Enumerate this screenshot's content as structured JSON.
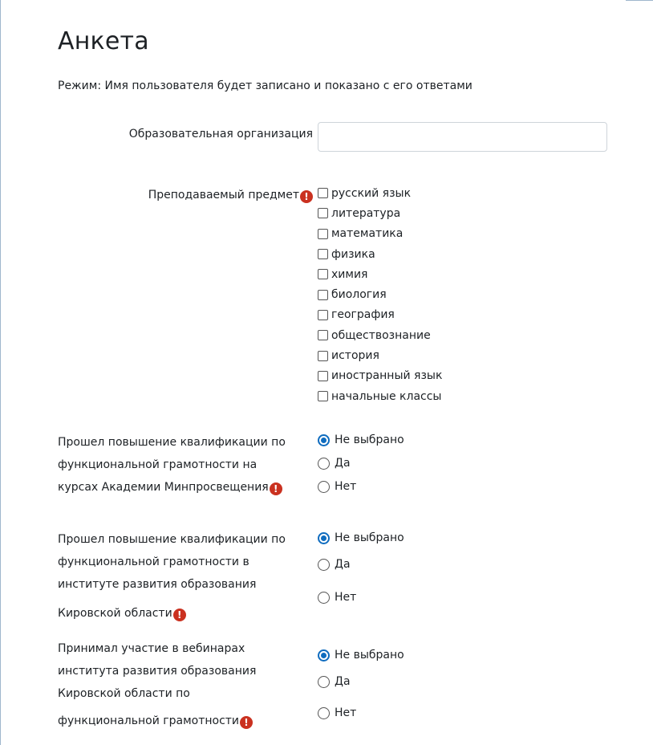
{
  "page": {
    "title": "Анкета",
    "mode_text": "Режим: Имя пользователя будет записано и показано с его ответами"
  },
  "organization": {
    "label": "Образовательная организация",
    "value": ""
  },
  "subject": {
    "label": "Преподаваемый предмет",
    "required": true,
    "options": [
      {
        "label": "русский язык",
        "checked": false
      },
      {
        "label": "литература",
        "checked": false
      },
      {
        "label": "математика",
        "checked": false
      },
      {
        "label": "физика",
        "checked": false
      },
      {
        "label": "химия",
        "checked": false
      },
      {
        "label": "биология",
        "checked": false
      },
      {
        "label": "география",
        "checked": false
      },
      {
        "label": "обществознание",
        "checked": false
      },
      {
        "label": "история",
        "checked": false
      },
      {
        "label": "иностранный язык",
        "checked": false
      },
      {
        "label": "начальные классы",
        "checked": false
      }
    ]
  },
  "questions": [
    {
      "label_lines": [
        "Прошел повышение квалификации по",
        "функциональной грамотности на",
        "курсах Академии Минпросвещения"
      ],
      "required": true,
      "options": [
        "Не выбрано",
        "Да",
        "Нет"
      ],
      "selected": "Не выбрано"
    },
    {
      "label_lines": [
        "Прошел повышение квалификации по",
        "функциональной грамотности в",
        "институте развития образования",
        "Кировской области"
      ],
      "required": true,
      "options": [
        "Не выбрано",
        "Да",
        "Нет"
      ],
      "selected": "Не выбрано"
    },
    {
      "label_lines": [
        "Принимал участие в вебинарах",
        "института развития образования",
        "Кировской области по",
        "функциональной грамотности"
      ],
      "required": true,
      "options": [
        "Не выбрано",
        "Да",
        "Нет"
      ],
      "selected": "Не выбрано"
    }
  ],
  "icons": {
    "required": "exclamation-circle-icon",
    "required_glyph": "!"
  },
  "colors": {
    "accent": "#0f6cbf",
    "required": "#ca3120",
    "text": "#1d2125",
    "input_border": "#ced4da"
  }
}
